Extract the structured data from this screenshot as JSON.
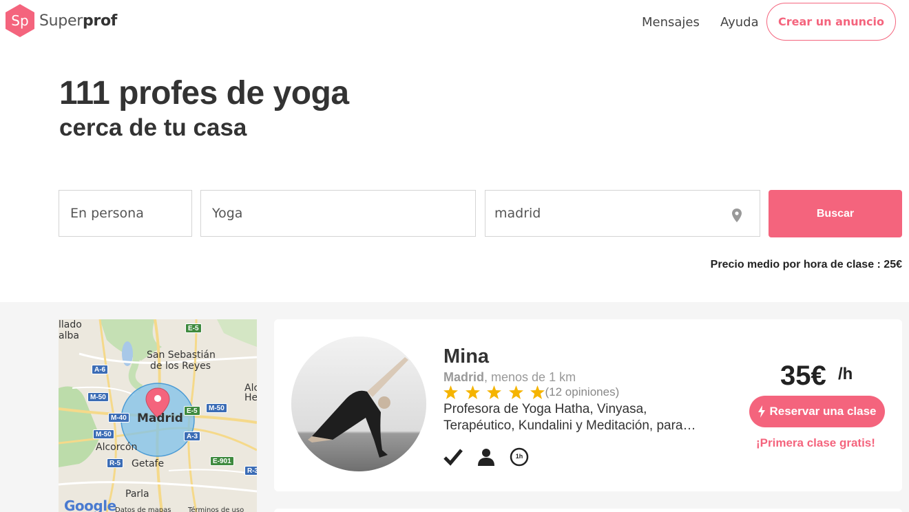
{
  "header": {
    "logo_badge": "Sp",
    "logo_text_light": "Super",
    "logo_text_bold": "prof",
    "nav": {
      "messages": "Mensajes",
      "help": "Ayuda"
    },
    "cta_label": "Crear un anuncio"
  },
  "hero": {
    "title": "111 profes de yoga",
    "subtitle": "cerca de tu casa"
  },
  "search": {
    "mode_value": "En persona",
    "subject_value": "Yoga",
    "location_value": "madrid",
    "button_label": "Buscar",
    "avg_price_text": "Precio medio por hora de clase : 25€"
  },
  "map": {
    "labels": {
      "llado": "llado",
      "alba": "alba",
      "san_sebastian_1": "San Sebastián",
      "san_sebastian_2": "de los Reyes",
      "madrid": "Madrid",
      "alcorcon": "Alcorcón",
      "getafe": "Getafe",
      "parla": "Parla",
      "alc": "Alc",
      "he": "He"
    },
    "shields": {
      "e5_top": "E-5",
      "a6": "A-6",
      "m50_left": "M-50",
      "m40": "M-40",
      "e5_mid": "E-5",
      "m50_right": "M-50",
      "a3": "A-3",
      "m50_low": "M-50",
      "r5": "R-5",
      "e901": "E-901",
      "r3": "R-3"
    },
    "google": "Google",
    "footer_data": "Datos de mapas",
    "footer_terms": "Términos de uso"
  },
  "tutor": {
    "name": "Mina",
    "city": "Madrid",
    "distance": ", menos de 1 km",
    "rating": 5,
    "reviews": "(12 opiniones)",
    "description": "Profesora de Yoga Hatha, Vinyasa, Terapéutico, Kundalini y Meditación, para…",
    "price": "35€",
    "price_unit": "/h",
    "book_label": "Reservar una clase",
    "free_lesson": "¡Primera clase gratis!",
    "feature_icons": [
      "checkmark-icon",
      "person-icon",
      "one-hour-icon"
    ],
    "one_hour_badge": "1h"
  },
  "colors": {
    "brand": "#f4647d",
    "text_dark": "#333333",
    "grey_bg": "#f5f5f5",
    "star": "#f5b400"
  }
}
